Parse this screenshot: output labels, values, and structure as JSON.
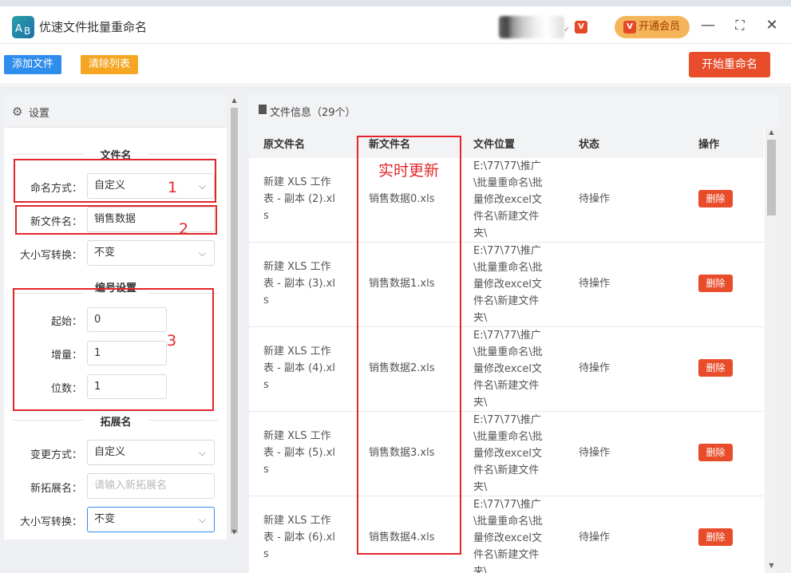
{
  "window": {
    "title": "优速文件批量重命名",
    "logo_letters": [
      "A",
      "B"
    ],
    "vip_label": "开通会员",
    "vip_icon": "V",
    "controls": {
      "minimize": "—",
      "maximize": "⛶",
      "close": "✕"
    }
  },
  "toolbar": {
    "add_label": "添加文件",
    "clear_label": "清除列表",
    "start_label": "开始重命名"
  },
  "settings": {
    "title": "设置",
    "filename_section": "文件名",
    "naming_mode_label": "命名方式：",
    "naming_mode_value": "自定义",
    "new_name_label": "新文件名：",
    "new_name_value": "销售数据",
    "case_label": "大小写转换：",
    "case_value": "不变",
    "numbering_section": "编号设置",
    "start_label": "起始：",
    "start_value": "0",
    "step_label": "增量：",
    "step_value": "1",
    "digits_label": "位数：",
    "digits_value": "1",
    "ext_section": "拓展名",
    "ext_mode_label": "变更方式：",
    "ext_mode_value": "自定义",
    "new_ext_label": "新拓展名：",
    "new_ext_placeholder": "请输入新拓展名",
    "ext_case_label": "大小写转换：",
    "ext_case_value": "不变"
  },
  "file_info": {
    "title": "文件信息（29个）",
    "columns": [
      "原文件名",
      "新文件名",
      "文件位置",
      "状态",
      "操作"
    ],
    "rows": [
      {
        "orig": [
          "新建 XLS 工作",
          "表 - 副本 (2).xl",
          "s"
        ],
        "new": "销售数据0.xls",
        "loc": [
          "E:\\77\\77\\推广",
          "\\批量重命名\\批",
          "量修改excel文",
          "件名\\新建文件",
          "夹\\"
        ],
        "status": "待操作",
        "action": "删除"
      },
      {
        "orig": [
          "新建 XLS 工作",
          "表 - 副本 (3).xl",
          "s"
        ],
        "new": "销售数据1.xls",
        "loc": [
          "E:\\77\\77\\推广",
          "\\批量重命名\\批",
          "量修改excel文",
          "件名\\新建文件",
          "夹\\"
        ],
        "status": "待操作",
        "action": "删除"
      },
      {
        "orig": [
          "新建 XLS 工作",
          "表 - 副本 (4).xl",
          "s"
        ],
        "new": "销售数据2.xls",
        "loc": [
          "E:\\77\\77\\推广",
          "\\批量重命名\\批",
          "量修改excel文",
          "件名\\新建文件",
          "夹\\"
        ],
        "status": "待操作",
        "action": "删除"
      },
      {
        "orig": [
          "新建 XLS 工作",
          "表 - 副本 (5).xl",
          "s"
        ],
        "new": "销售数据3.xls",
        "loc": [
          "E:\\77\\77\\推广",
          "\\批量重命名\\批",
          "量修改excel文",
          "件名\\新建文件",
          "夹\\"
        ],
        "status": "待操作",
        "action": "删除"
      },
      {
        "orig": [
          "新建 XLS 工作",
          "表 - 副本 (6).xl",
          "s"
        ],
        "new": "销售数据4.xls",
        "loc": [
          "E:\\77\\77\\推广",
          "\\批量重命名\\批",
          "量修改excel文",
          "件名\\新建文件",
          "夹\\"
        ],
        "status": "待操作",
        "action": "删除"
      }
    ]
  },
  "annotations": {
    "label_1": "1",
    "label_2": "2",
    "label_3": "3",
    "realtime": "实时更新"
  },
  "colors": {
    "primary_blue": "#2f8ded",
    "orange": "#f5a623",
    "red_action": "#e84c2a",
    "annotation_red": "#e3262a",
    "vip_bg": "#f5b55a"
  }
}
